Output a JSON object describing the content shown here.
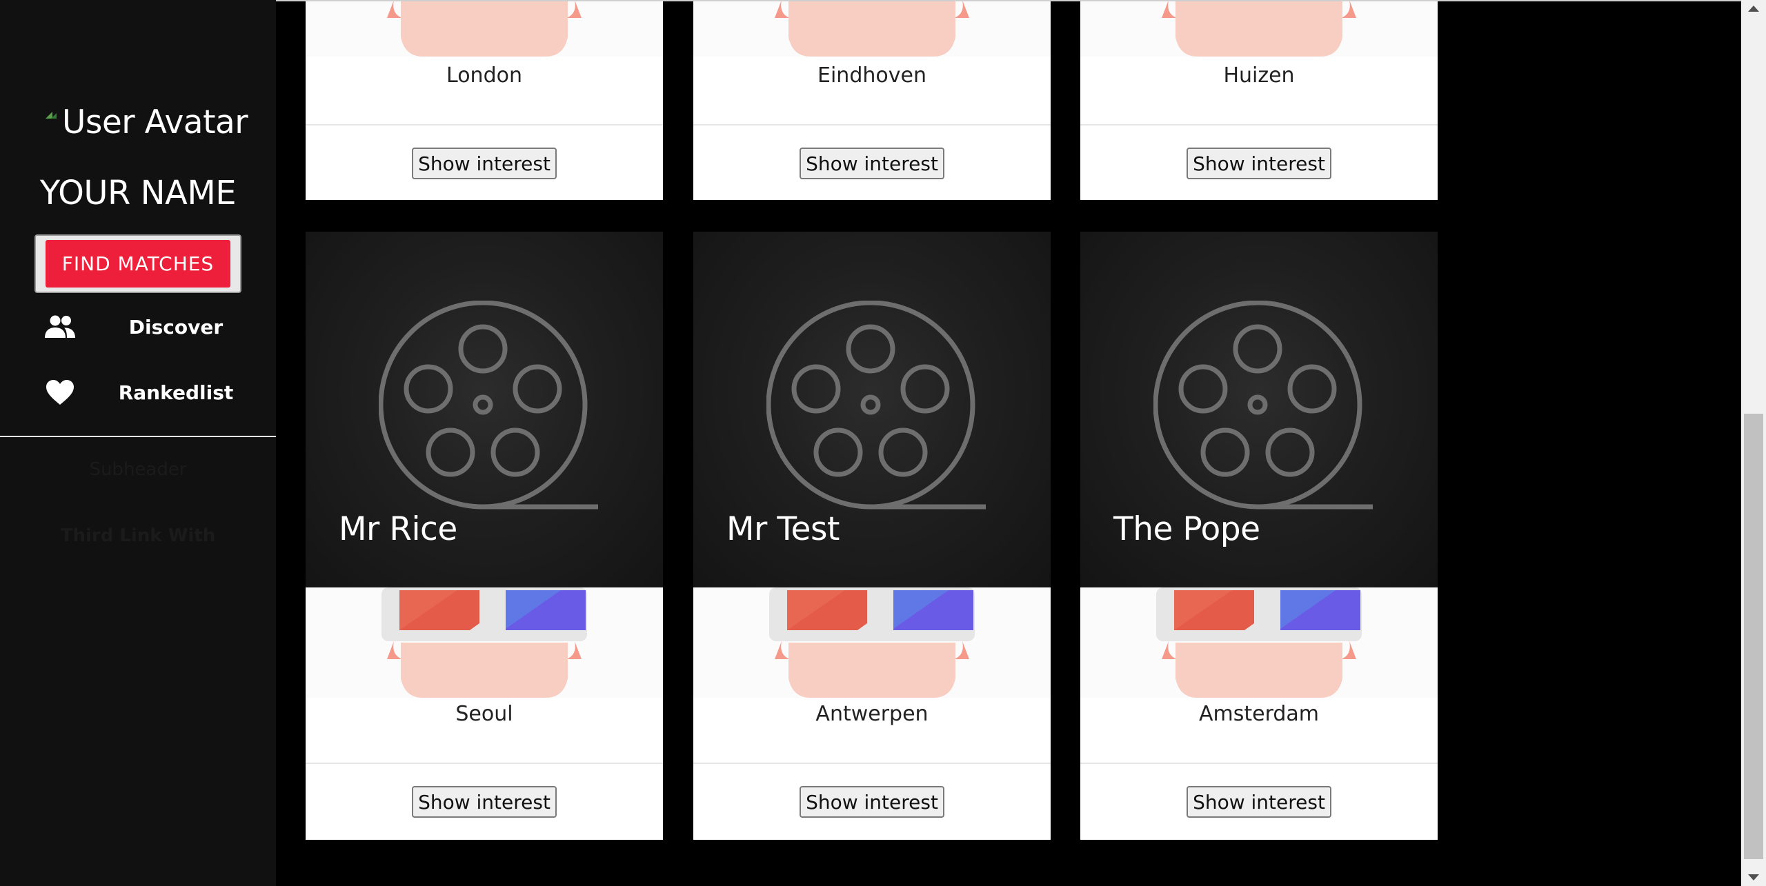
{
  "sidebar": {
    "avatar_alt": "User Avatar",
    "name": "YOUR NAME",
    "find_matches": "FIND MATCHES",
    "nav": [
      {
        "label": "Discover",
        "icon": "people-icon"
      },
      {
        "label": "Rankedlist",
        "icon": "heart-icon"
      }
    ],
    "subheader": "Subheader",
    "third_link": "Third Link With"
  },
  "cards_top": [
    {
      "city": "London",
      "button": "Show interest"
    },
    {
      "city": "Eindhoven",
      "button": "Show interest"
    },
    {
      "city": "Huizen",
      "button": "Show interest"
    }
  ],
  "cards": [
    {
      "title": "Mr Rice",
      "city": "Seoul",
      "button": "Show interest"
    },
    {
      "title": "Mr Test",
      "city": "Antwerpen",
      "button": "Show interest"
    },
    {
      "title": "The Pope",
      "city": "Amsterdam",
      "button": "Show interest"
    }
  ],
  "colors": {
    "accent": "#ee1f3a",
    "sidebar_bg": "#111111",
    "page_bg": "#000000"
  }
}
